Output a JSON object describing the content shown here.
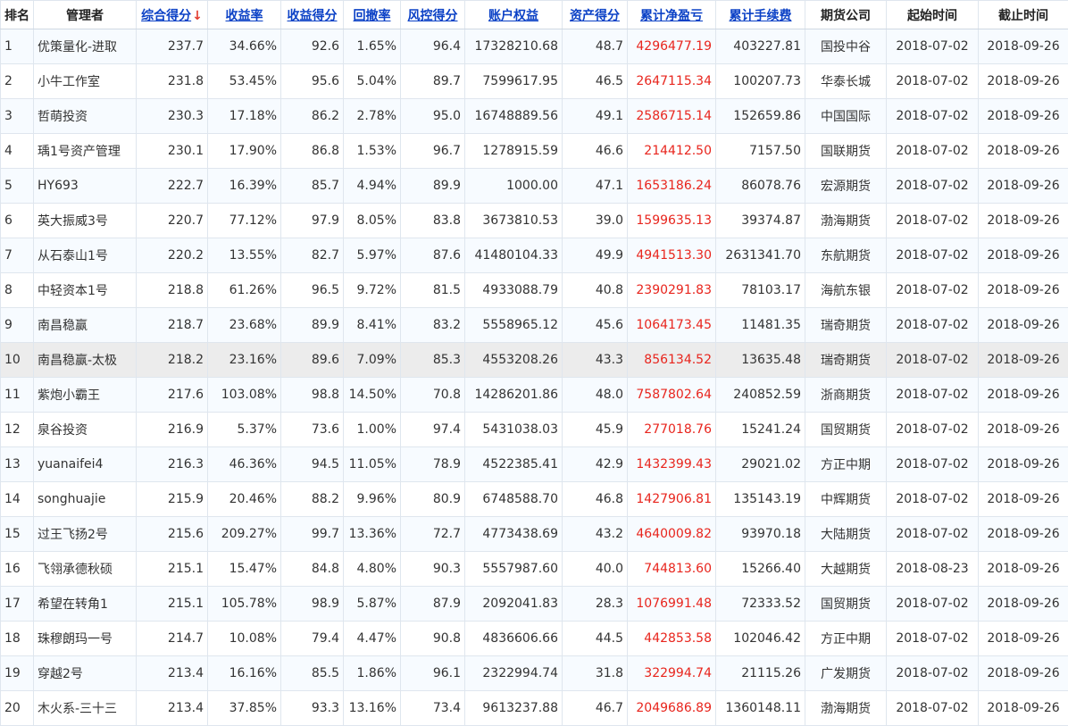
{
  "headers": [
    "排名",
    "管理者",
    "综合得分",
    "收益率",
    "收益得分",
    "回撤率",
    "风控得分",
    "账户权益",
    "资产得分",
    "累计净盈亏",
    "累计手续费",
    "期货公司",
    "起始时间",
    "截止时间"
  ],
  "sort_indicator": "↓",
  "rows": [
    {
      "rank": "1",
      "manager": "优策量化-进取",
      "score": "237.7",
      "return_rate": "34.66%",
      "return_score": "92.6",
      "drawdown": "1.65%",
      "risk_score": "96.4",
      "equity": "17328210.68",
      "asset_score": "48.7",
      "net_pnl": "4296477.19",
      "fees": "403227.81",
      "company": "国投中谷",
      "start": "2018-07-02",
      "end": "2018-09-26"
    },
    {
      "rank": "2",
      "manager": "小牛工作室",
      "score": "231.8",
      "return_rate": "53.45%",
      "return_score": "95.6",
      "drawdown": "5.04%",
      "risk_score": "89.7",
      "equity": "7599617.95",
      "asset_score": "46.5",
      "net_pnl": "2647115.34",
      "fees": "100207.73",
      "company": "华泰长城",
      "start": "2018-07-02",
      "end": "2018-09-26"
    },
    {
      "rank": "3",
      "manager": "哲萌投资",
      "score": "230.3",
      "return_rate": "17.18%",
      "return_score": "86.2",
      "drawdown": "2.78%",
      "risk_score": "95.0",
      "equity": "16748889.56",
      "asset_score": "49.1",
      "net_pnl": "2586715.14",
      "fees": "152659.86",
      "company": "中国国际",
      "start": "2018-07-02",
      "end": "2018-09-26"
    },
    {
      "rank": "4",
      "manager": "瑀1号资产管理",
      "score": "230.1",
      "return_rate": "17.90%",
      "return_score": "86.8",
      "drawdown": "1.53%",
      "risk_score": "96.7",
      "equity": "1278915.59",
      "asset_score": "46.6",
      "net_pnl": "214412.50",
      "fees": "7157.50",
      "company": "国联期货",
      "start": "2018-07-02",
      "end": "2018-09-26"
    },
    {
      "rank": "5",
      "manager": "HY693",
      "score": "222.7",
      "return_rate": "16.39%",
      "return_score": "85.7",
      "drawdown": "4.94%",
      "risk_score": "89.9",
      "equity": "1000.00",
      "asset_score": "47.1",
      "net_pnl": "1653186.24",
      "fees": "86078.76",
      "company": "宏源期货",
      "start": "2018-07-02",
      "end": "2018-09-26"
    },
    {
      "rank": "6",
      "manager": "英大振威3号",
      "score": "220.7",
      "return_rate": "77.12%",
      "return_score": "97.9",
      "drawdown": "8.05%",
      "risk_score": "83.8",
      "equity": "3673810.53",
      "asset_score": "39.0",
      "net_pnl": "1599635.13",
      "fees": "39374.87",
      "company": "渤海期货",
      "start": "2018-07-02",
      "end": "2018-09-26"
    },
    {
      "rank": "7",
      "manager": "从石泰山1号",
      "score": "220.2",
      "return_rate": "13.55%",
      "return_score": "82.7",
      "drawdown": "5.97%",
      "risk_score": "87.6",
      "equity": "41480104.33",
      "asset_score": "49.9",
      "net_pnl": "4941513.30",
      "fees": "2631341.70",
      "company": "东航期货",
      "start": "2018-07-02",
      "end": "2018-09-26"
    },
    {
      "rank": "8",
      "manager": "中轻资本1号",
      "score": "218.8",
      "return_rate": "61.26%",
      "return_score": "96.5",
      "drawdown": "9.72%",
      "risk_score": "81.5",
      "equity": "4933088.79",
      "asset_score": "40.8",
      "net_pnl": "2390291.83",
      "fees": "78103.17",
      "company": "海航东银",
      "start": "2018-07-02",
      "end": "2018-09-26"
    },
    {
      "rank": "9",
      "manager": "南昌稳赢",
      "score": "218.7",
      "return_rate": "23.68%",
      "return_score": "89.9",
      "drawdown": "8.41%",
      "risk_score": "83.2",
      "equity": "5558965.12",
      "asset_score": "45.6",
      "net_pnl": "1064173.45",
      "fees": "11481.35",
      "company": "瑞奇期货",
      "start": "2018-07-02",
      "end": "2018-09-26"
    },
    {
      "rank": "10",
      "manager": "南昌稳赢-太极",
      "score": "218.2",
      "return_rate": "23.16%",
      "return_score": "89.6",
      "drawdown": "7.09%",
      "risk_score": "85.3",
      "equity": "4553208.26",
      "asset_score": "43.3",
      "net_pnl": "856134.52",
      "fees": "13635.48",
      "company": "瑞奇期货",
      "start": "2018-07-02",
      "end": "2018-09-26"
    },
    {
      "rank": "11",
      "manager": "紫炮小霸王",
      "score": "217.6",
      "return_rate": "103.08%",
      "return_score": "98.8",
      "drawdown": "14.50%",
      "risk_score": "70.8",
      "equity": "14286201.86",
      "asset_score": "48.0",
      "net_pnl": "7587802.64",
      "fees": "240852.59",
      "company": "浙商期货",
      "start": "2018-07-02",
      "end": "2018-09-26"
    },
    {
      "rank": "12",
      "manager": "泉谷投资",
      "score": "216.9",
      "return_rate": "5.37%",
      "return_score": "73.6",
      "drawdown": "1.00%",
      "risk_score": "97.4",
      "equity": "5431038.03",
      "asset_score": "45.9",
      "net_pnl": "277018.76",
      "fees": "15241.24",
      "company": "国贸期货",
      "start": "2018-07-02",
      "end": "2018-09-26"
    },
    {
      "rank": "13",
      "manager": "yuanaifei4",
      "score": "216.3",
      "return_rate": "46.36%",
      "return_score": "94.5",
      "drawdown": "11.05%",
      "risk_score": "78.9",
      "equity": "4522385.41",
      "asset_score": "42.9",
      "net_pnl": "1432399.43",
      "fees": "29021.02",
      "company": "方正中期",
      "start": "2018-07-02",
      "end": "2018-09-26"
    },
    {
      "rank": "14",
      "manager": "songhuajie",
      "score": "215.9",
      "return_rate": "20.46%",
      "return_score": "88.2",
      "drawdown": "9.96%",
      "risk_score": "80.9",
      "equity": "6748588.70",
      "asset_score": "46.8",
      "net_pnl": "1427906.81",
      "fees": "135143.19",
      "company": "中辉期货",
      "start": "2018-07-02",
      "end": "2018-09-26"
    },
    {
      "rank": "15",
      "manager": "过王飞扬2号",
      "score": "215.6",
      "return_rate": "209.27%",
      "return_score": "99.7",
      "drawdown": "13.36%",
      "risk_score": "72.7",
      "equity": "4773438.69",
      "asset_score": "43.2",
      "net_pnl": "4640009.82",
      "fees": "93970.18",
      "company": "大陆期货",
      "start": "2018-07-02",
      "end": "2018-09-26"
    },
    {
      "rank": "16",
      "manager": "飞翎承德秋硕",
      "score": "215.1",
      "return_rate": "15.47%",
      "return_score": "84.8",
      "drawdown": "4.80%",
      "risk_score": "90.3",
      "equity": "5557987.60",
      "asset_score": "40.0",
      "net_pnl": "744813.60",
      "fees": "15266.40",
      "company": "大越期货",
      "start": "2018-08-23",
      "end": "2018-09-26"
    },
    {
      "rank": "17",
      "manager": "希望在转角1",
      "score": "215.1",
      "return_rate": "105.78%",
      "return_score": "98.9",
      "drawdown": "5.87%",
      "risk_score": "87.9",
      "equity": "2092041.83",
      "asset_score": "28.3",
      "net_pnl": "1076991.48",
      "fees": "72333.52",
      "company": "国贸期货",
      "start": "2018-07-02",
      "end": "2018-09-26"
    },
    {
      "rank": "18",
      "manager": "珠穆朗玛一号",
      "score": "214.7",
      "return_rate": "10.08%",
      "return_score": "79.4",
      "drawdown": "4.47%",
      "risk_score": "90.8",
      "equity": "4836606.66",
      "asset_score": "44.5",
      "net_pnl": "442853.58",
      "fees": "102046.42",
      "company": "方正中期",
      "start": "2018-07-02",
      "end": "2018-09-26"
    },
    {
      "rank": "19",
      "manager": "穿越2号",
      "score": "213.4",
      "return_rate": "16.16%",
      "return_score": "85.5",
      "drawdown": "1.86%",
      "risk_score": "96.1",
      "equity": "2322994.74",
      "asset_score": "31.8",
      "net_pnl": "322994.74",
      "fees": "21115.26",
      "company": "广发期货",
      "start": "2018-07-02",
      "end": "2018-09-26"
    },
    {
      "rank": "20",
      "manager": "木火系-三十三",
      "score": "213.4",
      "return_rate": "37.85%",
      "return_score": "93.3",
      "drawdown": "13.16%",
      "risk_score": "73.4",
      "equity": "9613237.88",
      "asset_score": "46.7",
      "net_pnl": "2049686.89",
      "fees": "1360148.11",
      "company": "渤海期货",
      "start": "2018-07-02",
      "end": "2018-09-26"
    }
  ]
}
